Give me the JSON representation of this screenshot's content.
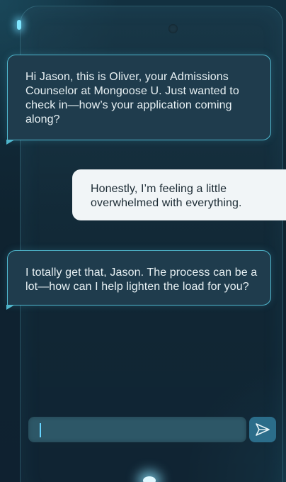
{
  "conversation": {
    "messages": [
      {
        "sender": "counselor",
        "text": "Hi Jason, this is Oliver, your Admissions Counselor at Mongoose U. Just wanted to check in—how’s your application coming along?"
      },
      {
        "sender": "student",
        "text": "Honestly, I’m feeling a little overwhelmed with everything."
      },
      {
        "sender": "counselor",
        "text": "I totally get that, Jason. The process can be a lot—how can I help lighten the load for you?"
      }
    ]
  },
  "composer": {
    "value": "",
    "send_icon": "send-icon"
  },
  "colors": {
    "incoming_bubble": "#1f3c4d",
    "incoming_border": "#4fb6cc",
    "outgoing_bubble": "#f1f5f7",
    "input_background": "#2d5767",
    "send_button": "#2b6d8a",
    "caret": "#66d4ff"
  }
}
